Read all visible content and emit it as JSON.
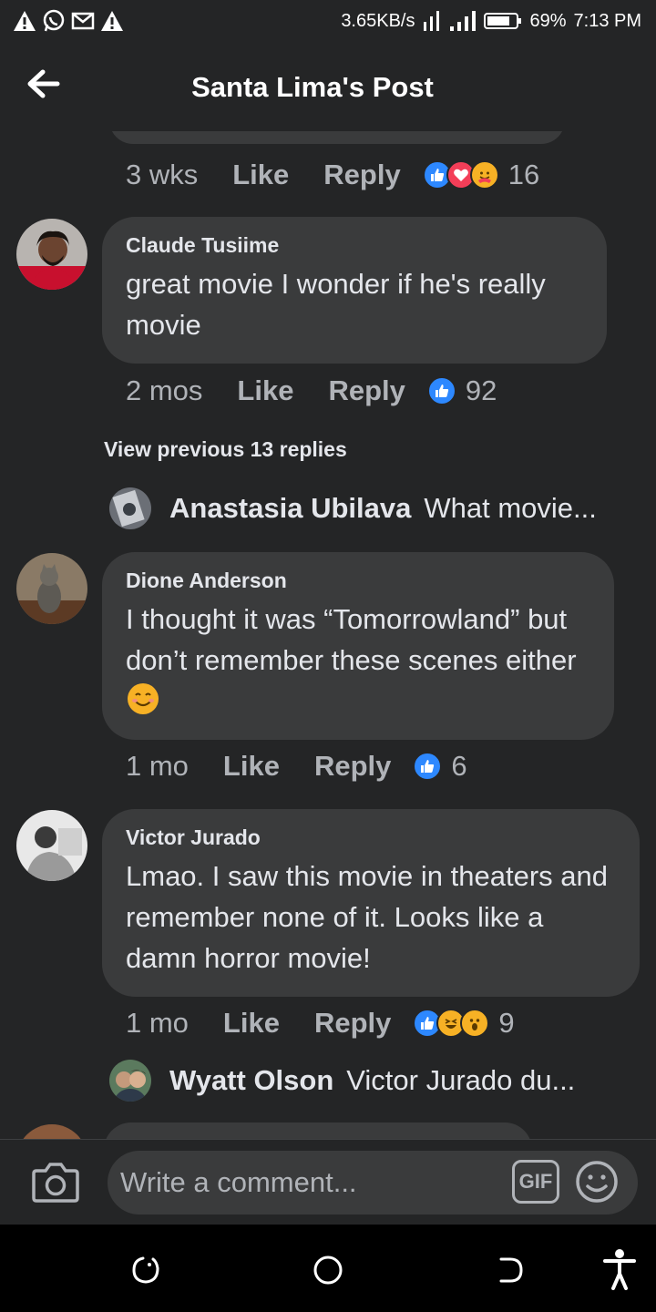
{
  "status_bar": {
    "speed": "3.65KB/s",
    "battery": "69%",
    "time": "7:13 PM",
    "left_icons": [
      "alert-icon",
      "whatsapp-icon",
      "gmail-icon",
      "alert-icon"
    ]
  },
  "header": {
    "title": "Santa Lima's Post"
  },
  "top_meta": {
    "time": "3 wks",
    "like": "Like",
    "reply": "Reply",
    "reactions": [
      "like",
      "love",
      "care"
    ],
    "count": "16"
  },
  "comments": [
    {
      "author": "Claude Tusiime",
      "text": "great movie I wonder if he's really movie",
      "time": "2 mos",
      "like": "Like",
      "reply": "Reply",
      "reactions": [
        "like"
      ],
      "count": "92"
    },
    {
      "author": "Dione Anderson",
      "text": "I thought it was “Tomorrowland” but don’t remember these scenes either",
      "time": "1 mo",
      "like": "Like",
      "reply": "Reply",
      "reactions": [
        "like"
      ],
      "count": "6"
    },
    {
      "author": "Victor Jurado",
      "text": "Lmao. I saw this movie in theaters and remember none of it. Looks like a damn horror movie!",
      "time": "1 mo",
      "like": "Like",
      "reply": "Reply",
      "reactions": [
        "like",
        "haha",
        "wow"
      ],
      "count": "9"
    }
  ],
  "view_previous": "View previous 13 replies",
  "reply_previews": [
    {
      "name": "Anastasia Ubilava",
      "text": "What movie..."
    },
    {
      "name": "Wyatt Olson",
      "text": "Victor Jurado du..."
    }
  ],
  "composer": {
    "placeholder": "Write a comment...",
    "gif_label": "GIF"
  },
  "colors": {
    "background": "#242526",
    "bubble": "#3a3b3c",
    "like_blue": "#2d88ff",
    "love_red": "#f33e58",
    "emoji_yellow": "#f7b125",
    "secondary_text": "#b0b3b8"
  }
}
